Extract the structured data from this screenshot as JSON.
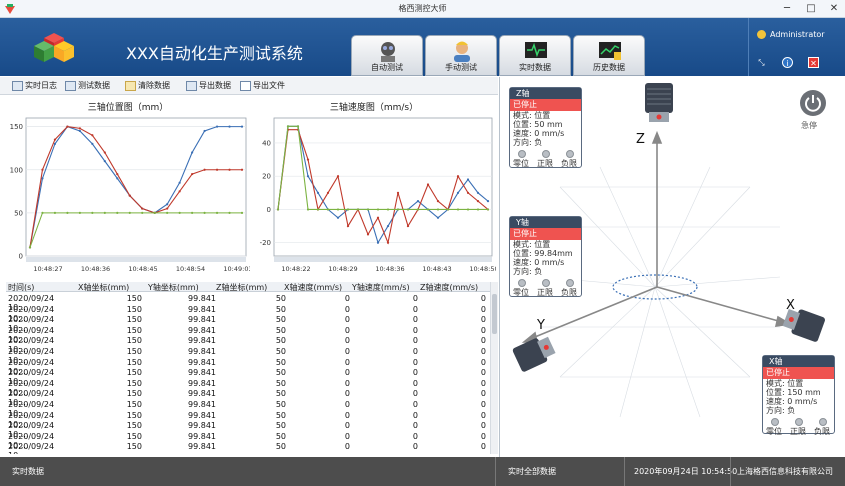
{
  "window": {
    "title": "格西测控大师",
    "min": "─",
    "max": "□",
    "close": "✕"
  },
  "header": {
    "system_title": "XXX自动化生产测试系统",
    "tabs": [
      {
        "label": "自动测试",
        "icon": "robot-icon"
      },
      {
        "label": "手动测试",
        "icon": "operator-icon"
      },
      {
        "label": "实时数据",
        "icon": "pulse-monitor-icon"
      },
      {
        "label": "历史数据",
        "icon": "history-chart-icon"
      }
    ],
    "user": "Administrator"
  },
  "toolbar": {
    "items": [
      "实时日志",
      "测试数据",
      "清除数据",
      "导出数据",
      "导出文件"
    ]
  },
  "position_chart": {
    "title": "三轴位置图（mm）",
    "chart_data": {
      "type": "line",
      "title": "三轴位置图（mm）",
      "xlabel": "",
      "ylabel": "",
      "ylim": [
        0,
        160
      ],
      "yticks": [
        "150",
        "100",
        "50",
        "0"
      ],
      "xticks": [
        "10:48:27",
        "10:48:36",
        "10:48:45",
        "10:48:54",
        "10:49:03"
      ],
      "grid": true,
      "series": [
        {
          "color": "#3a6fb5",
          "values": [
            10,
            90,
            130,
            150,
            145,
            130,
            110,
            90,
            70,
            55,
            50,
            60,
            85,
            120,
            145,
            150,
            150,
            150
          ]
        },
        {
          "color": "#c0392b",
          "values": [
            10,
            100,
            135,
            150,
            148,
            140,
            120,
            95,
            70,
            55,
            50,
            55,
            75,
            95,
            100,
            100,
            100,
            100
          ]
        },
        {
          "color": "#7cb342",
          "values": [
            10,
            50,
            50,
            50,
            50,
            50,
            50,
            50,
            50,
            50,
            50,
            50,
            50,
            50,
            50,
            50,
            50,
            50
          ]
        }
      ]
    }
  },
  "speed_chart": {
    "title": "三轴速度图（mm/s）",
    "chart_data": {
      "type": "line",
      "title": "三轴速度图（mm/s）",
      "xlabel": "",
      "ylabel": "",
      "ylim": [
        -28,
        55
      ],
      "yticks": [
        "40",
        "20",
        "0",
        "-20"
      ],
      "xticks": [
        "10:48:22",
        "10:48:29",
        "10:48:36",
        "10:48:43",
        "10:48:50"
      ],
      "grid": true,
      "series": [
        {
          "color": "#3a6fb5",
          "values": [
            0,
            50,
            50,
            20,
            10,
            0,
            -5,
            0,
            0,
            0,
            -20,
            -10,
            0,
            0,
            5,
            0,
            -5,
            0,
            10,
            18,
            10,
            5
          ]
        },
        {
          "color": "#c0392b",
          "values": [
            0,
            48,
            48,
            30,
            0,
            10,
            20,
            -10,
            0,
            -15,
            -5,
            -20,
            10,
            -10,
            0,
            15,
            5,
            0,
            20,
            10,
            5,
            0
          ]
        },
        {
          "color": "#7cb342",
          "values": [
            0,
            50,
            50,
            0,
            0,
            0,
            0,
            0,
            0,
            0,
            0,
            0,
            0,
            0,
            0,
            0,
            0,
            0,
            0,
            0,
            0,
            0
          ]
        }
      ]
    }
  },
  "table": {
    "headers": [
      "时间(s)",
      "X轴坐标(mm)",
      "Y轴坐标(mm)",
      "Z轴坐标(mm)",
      "X轴速度(mm/s)",
      "Y轴速度(mm/s)",
      "Z轴速度(mm/s)"
    ],
    "rows": [
      [
        "2020/09/24 10:...",
        "150",
        "99.841",
        "50",
        "0",
        "0",
        "0"
      ],
      [
        "2020/09/24 10:...",
        "150",
        "99.841",
        "50",
        "0",
        "0",
        "0"
      ],
      [
        "2020/09/24 10:...",
        "150",
        "99.841",
        "50",
        "0",
        "0",
        "0"
      ],
      [
        "2020/09/24 10:...",
        "150",
        "99.841",
        "50",
        "0",
        "0",
        "0"
      ],
      [
        "2020/09/24 10:...",
        "150",
        "99.841",
        "50",
        "0",
        "0",
        "0"
      ],
      [
        "2020/09/24 10:...",
        "150",
        "99.841",
        "50",
        "0",
        "0",
        "0"
      ],
      [
        "2020/09/24 10:...",
        "150",
        "99.841",
        "50",
        "0",
        "0",
        "0"
      ],
      [
        "2020/09/24 10:...",
        "150",
        "99.841",
        "50",
        "0",
        "0",
        "0"
      ],
      [
        "2020/09/24 10:...",
        "150",
        "99.841",
        "50",
        "0",
        "0",
        "0"
      ],
      [
        "2020/09/24 10:...",
        "150",
        "99.841",
        "50",
        "0",
        "0",
        "0"
      ],
      [
        "2020/09/24 10:...",
        "150",
        "99.841",
        "50",
        "0",
        "0",
        "0"
      ],
      [
        "2020/09/24 10:...",
        "150",
        "99.841",
        "50",
        "0",
        "0",
        "0"
      ],
      [
        "2020/09/24 10:...",
        "150",
        "99.841",
        "50",
        "0",
        "0",
        "0"
      ],
      [
        "2020/09/24 10:...",
        "150",
        "99.841",
        "50",
        "0",
        "0",
        "0"
      ],
      [
        "2020/09/24 10:...",
        "150",
        "99.841",
        "50",
        "0",
        "0",
        "0"
      ]
    ]
  },
  "axes": {
    "z": {
      "name": "Z轴",
      "status": "已停止",
      "mode": "模式: 位置",
      "pos": "位置: 50",
      "pos_unit": "mm",
      "speed": "速度: 0",
      "speed_unit": "mm/s",
      "dir": "方向: 负",
      "leds": [
        "零位",
        "正限",
        "负限"
      ]
    },
    "y": {
      "name": "Y轴",
      "status": "已停止",
      "mode": "模式: 位置",
      "pos": "位置: 99.84mm",
      "pos_unit": "",
      "speed": "速度: 0",
      "speed_unit": "mm/s",
      "dir": "方向: 负",
      "leds": [
        "零位",
        "正限",
        "负限"
      ]
    },
    "x": {
      "name": "X轴",
      "status": "已停止",
      "mode": "模式: 位置",
      "pos": "位置: 150",
      "pos_unit": "mm",
      "speed": "速度: 0",
      "speed_unit": "mm/s",
      "dir": "方向: 负",
      "leds": [
        "零位",
        "正限",
        "负限"
      ]
    }
  },
  "axis_labels": {
    "x": "X",
    "y": "Y",
    "z": "Z"
  },
  "stop_label": "急停",
  "status": {
    "left": "实时数据",
    "mid": "实时全部数据",
    "datetime": "2020年09月24日 10:54:50",
    "company": "上海格西信息科技有限公司"
  },
  "colors": {
    "header": "#1f5496",
    "status_bar": "#4d4d4d",
    "stopped": "#ef5350"
  }
}
